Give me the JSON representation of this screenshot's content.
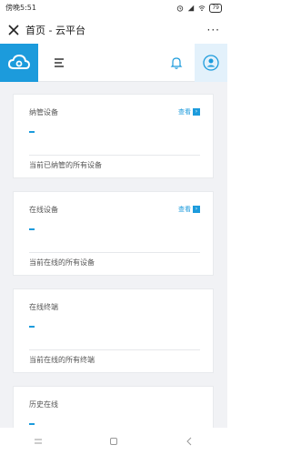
{
  "status": {
    "time": "傍晚5:51",
    "battery": "79"
  },
  "titlebar": {
    "title": "首页 - 云平台",
    "more": "···"
  },
  "cards": [
    {
      "title": "纳管设备",
      "badge": "查看",
      "value": "-",
      "note": "当前已纳管的所有设备"
    },
    {
      "title": "在线设备",
      "badge": "查看",
      "value": "-",
      "note": "当前在线的所有设备"
    },
    {
      "title": "在线终端",
      "value": "-",
      "note": "当前在线的所有终端"
    },
    {
      "title": "历史在线",
      "value": "-",
      "note": ""
    }
  ],
  "colors": {
    "accent": "#1c9bdc",
    "header_bg": "#ffffff",
    "page_bg": "#f1f2f5"
  },
  "icons": {
    "logo": "cloud-logo-icon",
    "menu": "menu-toggle-icon",
    "bell": "bell-icon",
    "user": "user-avatar-icon",
    "close": "close-icon",
    "back": "back-icon",
    "home": "home-icon",
    "recent": "recent-apps-icon"
  }
}
